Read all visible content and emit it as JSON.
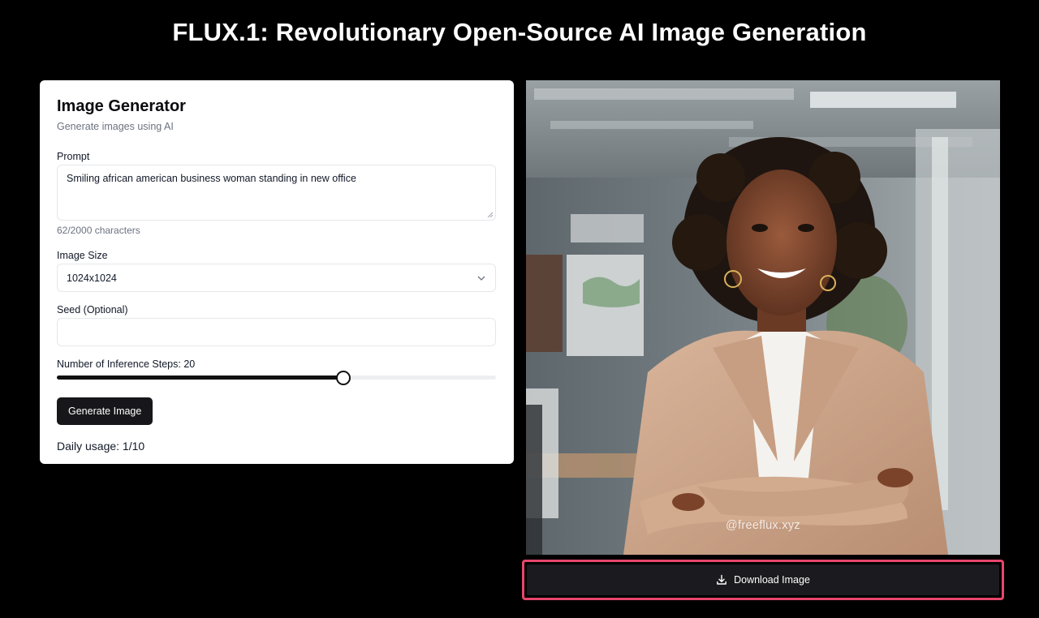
{
  "page": {
    "title": "FLUX.1: Revolutionary Open-Source AI Image Generation"
  },
  "card": {
    "title": "Image Generator",
    "subtitle": "Generate images using AI",
    "prompt": {
      "label": "Prompt",
      "value": "Smiling african american business woman standing in new office",
      "char_count": "62/2000 characters"
    },
    "image_size": {
      "label": "Image Size",
      "selected": "1024x1024"
    },
    "seed": {
      "label": "Seed (Optional)",
      "value": ""
    },
    "steps": {
      "label": "Number of Inference Steps: 20",
      "value": 20,
      "fraction": 0.65
    },
    "generate_label": "Generate Image",
    "usage": "Daily usage: 1/10"
  },
  "image": {
    "watermark": "@freeflux.xyz",
    "description_icon": "generated-image"
  },
  "download": {
    "label": "Download Image",
    "icon": "download-icon",
    "highlight_color": "#e8466c"
  },
  "colors": {
    "background": "#000000",
    "card": "#ffffff",
    "primary_button": "#17171b"
  }
}
